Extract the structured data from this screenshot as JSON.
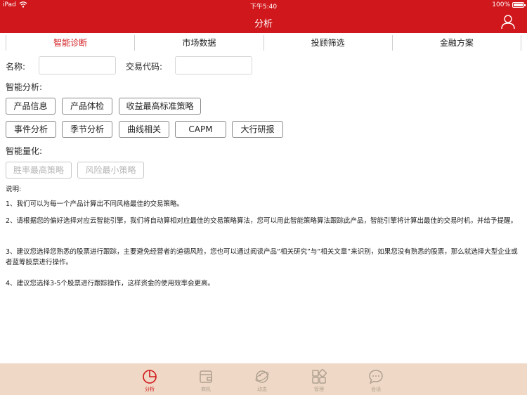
{
  "status_bar": {
    "device": "iPad",
    "time": "下午5:40",
    "battery": "100%"
  },
  "nav": {
    "title": "分析"
  },
  "tabs": [
    {
      "label": "智能诊断",
      "active": true
    },
    {
      "label": "市场数据",
      "active": false
    },
    {
      "label": "投顾筛选",
      "active": false
    },
    {
      "label": "金融方案",
      "active": false
    }
  ],
  "form": {
    "name_label": "名称:",
    "name_value": "",
    "code_label": "交易代码:",
    "code_value": ""
  },
  "smart_analysis": {
    "label": "智能分析:",
    "buttons": [
      "产品信息",
      "产品体检",
      "收益最高标准策略",
      "事件分析",
      "季节分析",
      "曲线相关",
      "CAPM",
      "大行研报"
    ]
  },
  "smart_quant": {
    "label": "智能量化:",
    "buttons": [
      "胜率最高策略",
      "风险最小策略"
    ]
  },
  "notes": {
    "title": "说明:",
    "items": [
      "1、我们可以为每一个产品计算出不同风格最佳的交易策略。",
      "2、请根据您的偏好选择对应云智能引擎，我们将自动算相对应最佳的交易策略算法，您可以用此智能策略算法跟踪此产品，智能引擎将计算出最佳的交易时机，并给予提醒。",
      "3、建议您选择您熟悉的股票进行跟踪，主要避免经营者的道德风险，您也可以通过阅读产品“相关研究”与“相关文章”来识别，如果您没有熟悉的股票，那么就选择大型企业或者蓝筹股票进行操作。",
      "4、建议您选择3-5个股票进行跟踪操作，这样资金的使用效率会更高。"
    ]
  },
  "tab_bar": {
    "items": [
      {
        "label": "分析",
        "icon": "pie-chart-icon",
        "active": true
      },
      {
        "label": "商机",
        "icon": "wallet-icon",
        "active": false
      },
      {
        "label": "动态",
        "icon": "planet-icon",
        "active": false
      },
      {
        "label": "管理",
        "icon": "grid-icon",
        "active": false
      },
      {
        "label": "会话",
        "icon": "chat-bubble-icon",
        "active": false
      }
    ]
  },
  "colors": {
    "brand": "#d0171b",
    "tab_bar_bg": "#efd9c6",
    "inactive_tab_icon": "#b0a090"
  }
}
